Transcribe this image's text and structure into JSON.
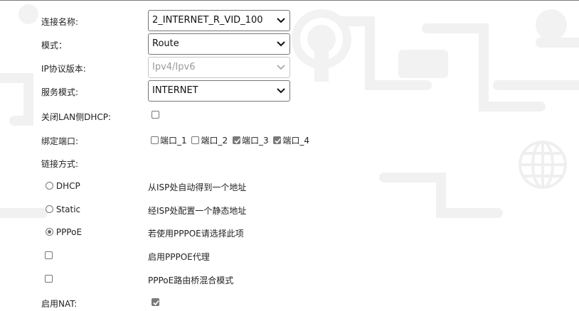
{
  "form": {
    "connection_name": {
      "label": "连接名称:",
      "value": "2_INTERNET_R_VID_100"
    },
    "mode": {
      "label": "模式：",
      "value": "Route"
    },
    "ip_version": {
      "label": "IP协议版本:",
      "value": "Ipv4/Ipv6",
      "disabled": true
    },
    "service_mode": {
      "label": "服务模式:",
      "value": "INTERNET"
    },
    "disable_lan_dhcp": {
      "label": "关闭LAN侧DHCP:",
      "checked": false
    },
    "bind_ports": {
      "label": "绑定端口:",
      "ports": [
        {
          "label": "端口_1",
          "checked": false
        },
        {
          "label": "端口_2",
          "checked": false
        },
        {
          "label": "端口_3",
          "checked": true
        },
        {
          "label": "端口_4",
          "checked": true
        }
      ]
    },
    "link_method": {
      "label": "链接方式:"
    },
    "link_options": [
      {
        "label": "DHCP",
        "desc": "从ISP处自动得到一个地址",
        "selected": false
      },
      {
        "label": "Static",
        "desc": "经ISP处配置一个静态地址",
        "selected": false
      },
      {
        "label": "PPPoE",
        "desc": "若使用PPPOE请选择此项",
        "selected": true
      }
    ],
    "pppoe_proxy": {
      "desc": "启用PPPOE代理",
      "checked": false
    },
    "pppoe_bridge_mix": {
      "desc": "PPPoE路由桥混合模式",
      "checked": false
    },
    "enable_nat": {
      "label": "启用NAT:",
      "checked": true
    }
  },
  "colors": {
    "background": "#ffffff",
    "watermark": "#f3f3f3",
    "border": "#767676",
    "check_fill": "#7a7a7a"
  }
}
